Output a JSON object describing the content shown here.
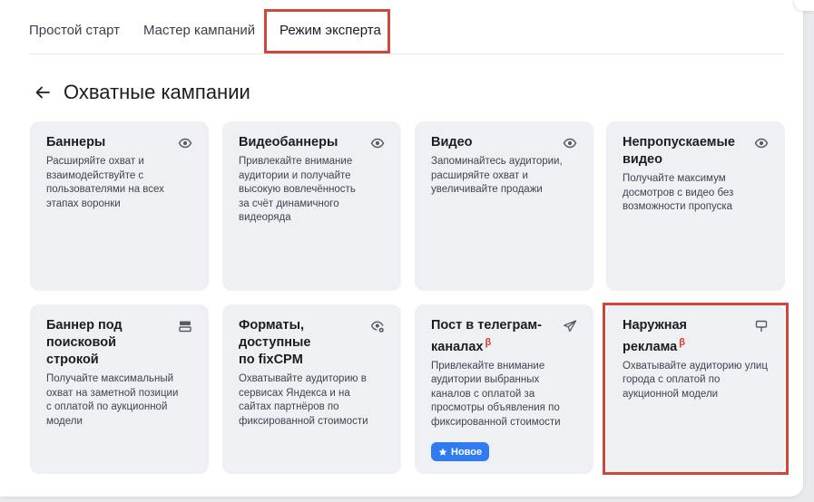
{
  "tabs": [
    {
      "label": "Простой старт"
    },
    {
      "label": "Мастер кампаний"
    },
    {
      "label": "Режим эксперта"
    }
  ],
  "section": {
    "title": "Охватные кампании"
  },
  "beta_mark": "β",
  "cards": [
    {
      "title": "Баннеры",
      "desc": "Расширяйте охват и взаимодействуйте с пользователями на всех этапах воронки",
      "icon": "eye-icon"
    },
    {
      "title": "Видеобаннеры",
      "desc": "Привлекайте внимание аудитории и получайте высокую вовлечённость за счёт динамичного видеоряда",
      "icon": "eye-icon"
    },
    {
      "title": "Видео",
      "desc": "Запоминайтесь аудитории, расширяйте охват и увеличивайте продажи",
      "icon": "eye-icon"
    },
    {
      "title": "Непропускаемые видео",
      "desc": "Получайте максимум досмотров с видео без возможности пропуска",
      "icon": "eye-icon"
    },
    {
      "title": "Баннер под поисковой строкой",
      "desc": "Получайте максимальный охват на заметной позиции с оплатой по аукционной модели",
      "icon": "search-banner-icon"
    },
    {
      "title": "Форматы, доступные по fixCPM",
      "desc": "Охватывайте аудиторию в сервисах Яндекса и на сайтах партнёров по фиксированной стоимости",
      "icon": "eye-gear-icon"
    },
    {
      "title": "Пост в телеграм-каналах",
      "desc": "Привлекайте внимание аудитории выбранных каналов с оплатой за просмотры объявления по фиксированной стоимости",
      "icon": "telegram-icon",
      "badge": "Новое"
    },
    {
      "title": "Наружная реклама",
      "desc": "Охватывайте аудиторию улиц города с оплатой по аукционной модели",
      "icon": "billboard-icon"
    }
  ]
}
